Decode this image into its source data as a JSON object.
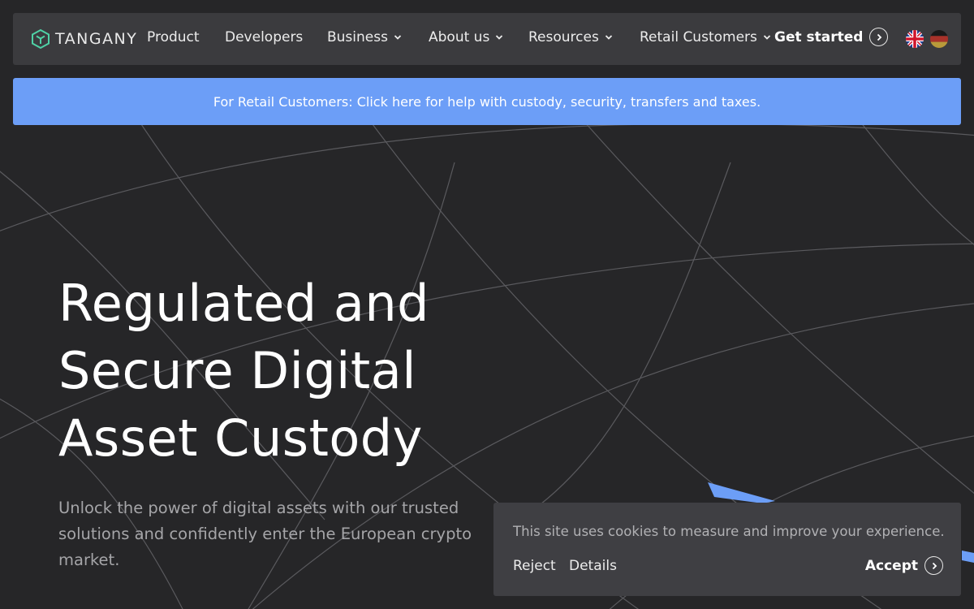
{
  "brand": {
    "name": "TANGANY",
    "accent": "#6c9ef7",
    "logo_color": "#4fd1a5"
  },
  "nav": {
    "items": [
      {
        "label": "Product",
        "has_dropdown": false
      },
      {
        "label": "Developers",
        "has_dropdown": false
      },
      {
        "label": "Business",
        "has_dropdown": true
      },
      {
        "label": "About us",
        "has_dropdown": true
      },
      {
        "label": "Resources",
        "has_dropdown": true
      },
      {
        "label": "Retail Customers",
        "has_dropdown": true
      }
    ],
    "cta_label": "Get started",
    "languages": [
      "en-flag-icon",
      "de-flag-icon"
    ]
  },
  "banner": {
    "text": "For Retail Customers: Click here for help with custody, security, transfers and taxes."
  },
  "hero": {
    "title_lines": [
      "Regulated and",
      "Secure Digital",
      "Asset Custody"
    ],
    "subtitle": "Unlock the power of digital assets with our trusted solutions and confidently enter the European crypto market."
  },
  "cookie": {
    "text": "This site uses cookies to measure and improve your experience.",
    "reject_label": "Reject",
    "details_label": "Details",
    "accept_label": "Accept"
  }
}
